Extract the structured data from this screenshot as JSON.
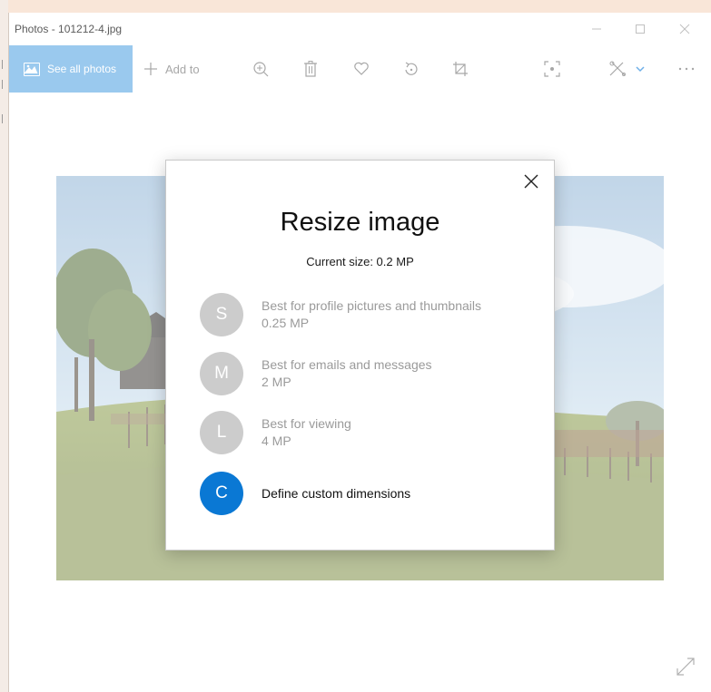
{
  "window": {
    "title": "Photos - 101212-4.jpg",
    "controls": [
      "minimize-icon",
      "maximize-icon",
      "close-icon"
    ]
  },
  "toolbar": {
    "see_all_label": "See all photos",
    "add_to_label": "Add to",
    "icons": [
      "zoom-in-icon",
      "delete-icon",
      "favorite-heart-icon",
      "rotate-icon",
      "crop-icon",
      "visual-search-icon",
      "edit-create-icon",
      "more-icon"
    ]
  },
  "dialog": {
    "title": "Resize image",
    "current_size": "Current size: 0.2 MP",
    "options": [
      {
        "letter": "S",
        "label": "Best for profile pictures and thumbnails",
        "size": "0.25 MP"
      },
      {
        "letter": "M",
        "label": "Best for emails and messages",
        "size": "2 MP"
      },
      {
        "letter": "L",
        "label": "Best for viewing",
        "size": "4 MP"
      },
      {
        "letter": "C",
        "label": "Define custom dimensions"
      }
    ]
  },
  "colors": {
    "accent": "#0a78d4",
    "see_all_bg": "#9ac9ee",
    "option_circle": "#cccccc",
    "desktop_bg": "#f9e6d8"
  }
}
